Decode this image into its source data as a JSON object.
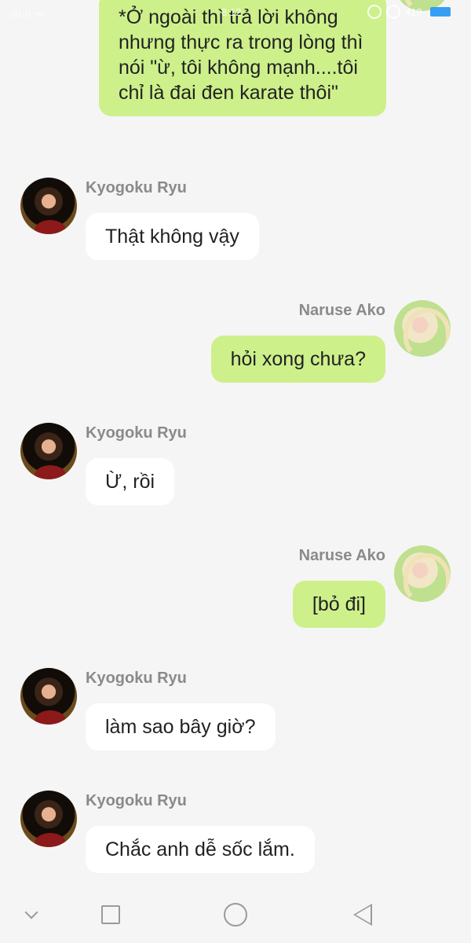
{
  "status_bar": {
    "signal_text": ".ıll.ıl ᯤ",
    "time": "8:12",
    "battery_text": "419"
  },
  "messages": [
    {
      "side": "out",
      "text": "*Ở ngoài thì trả lời không nhưng thực ra trong lòng thì nói \"ừ, tôi không mạnh....tôi chỉ là đai đen karate thôi\""
    },
    {
      "side": "in",
      "sender": "Kyogoku Ryu",
      "text": "Thật không vậy"
    },
    {
      "side": "out",
      "sender": "Naruse Ako",
      "text": "hỏi xong chưa?"
    },
    {
      "side": "in",
      "sender": "Kyogoku Ryu",
      "text": "Ừ, rồi"
    },
    {
      "side": "out",
      "sender": "Naruse Ako",
      "text": "[bỏ đi]"
    },
    {
      "side": "in",
      "sender": "Kyogoku Ryu",
      "text": "làm sao bây giờ?"
    },
    {
      "side": "in",
      "sender": "Kyogoku Ryu",
      "text": "Chắc anh dễ sốc lắm."
    }
  ],
  "nav_bar": {
    "icons": [
      "chevron-down-icon",
      "square-icon",
      "circle-icon",
      "triangle-back-icon"
    ]
  }
}
